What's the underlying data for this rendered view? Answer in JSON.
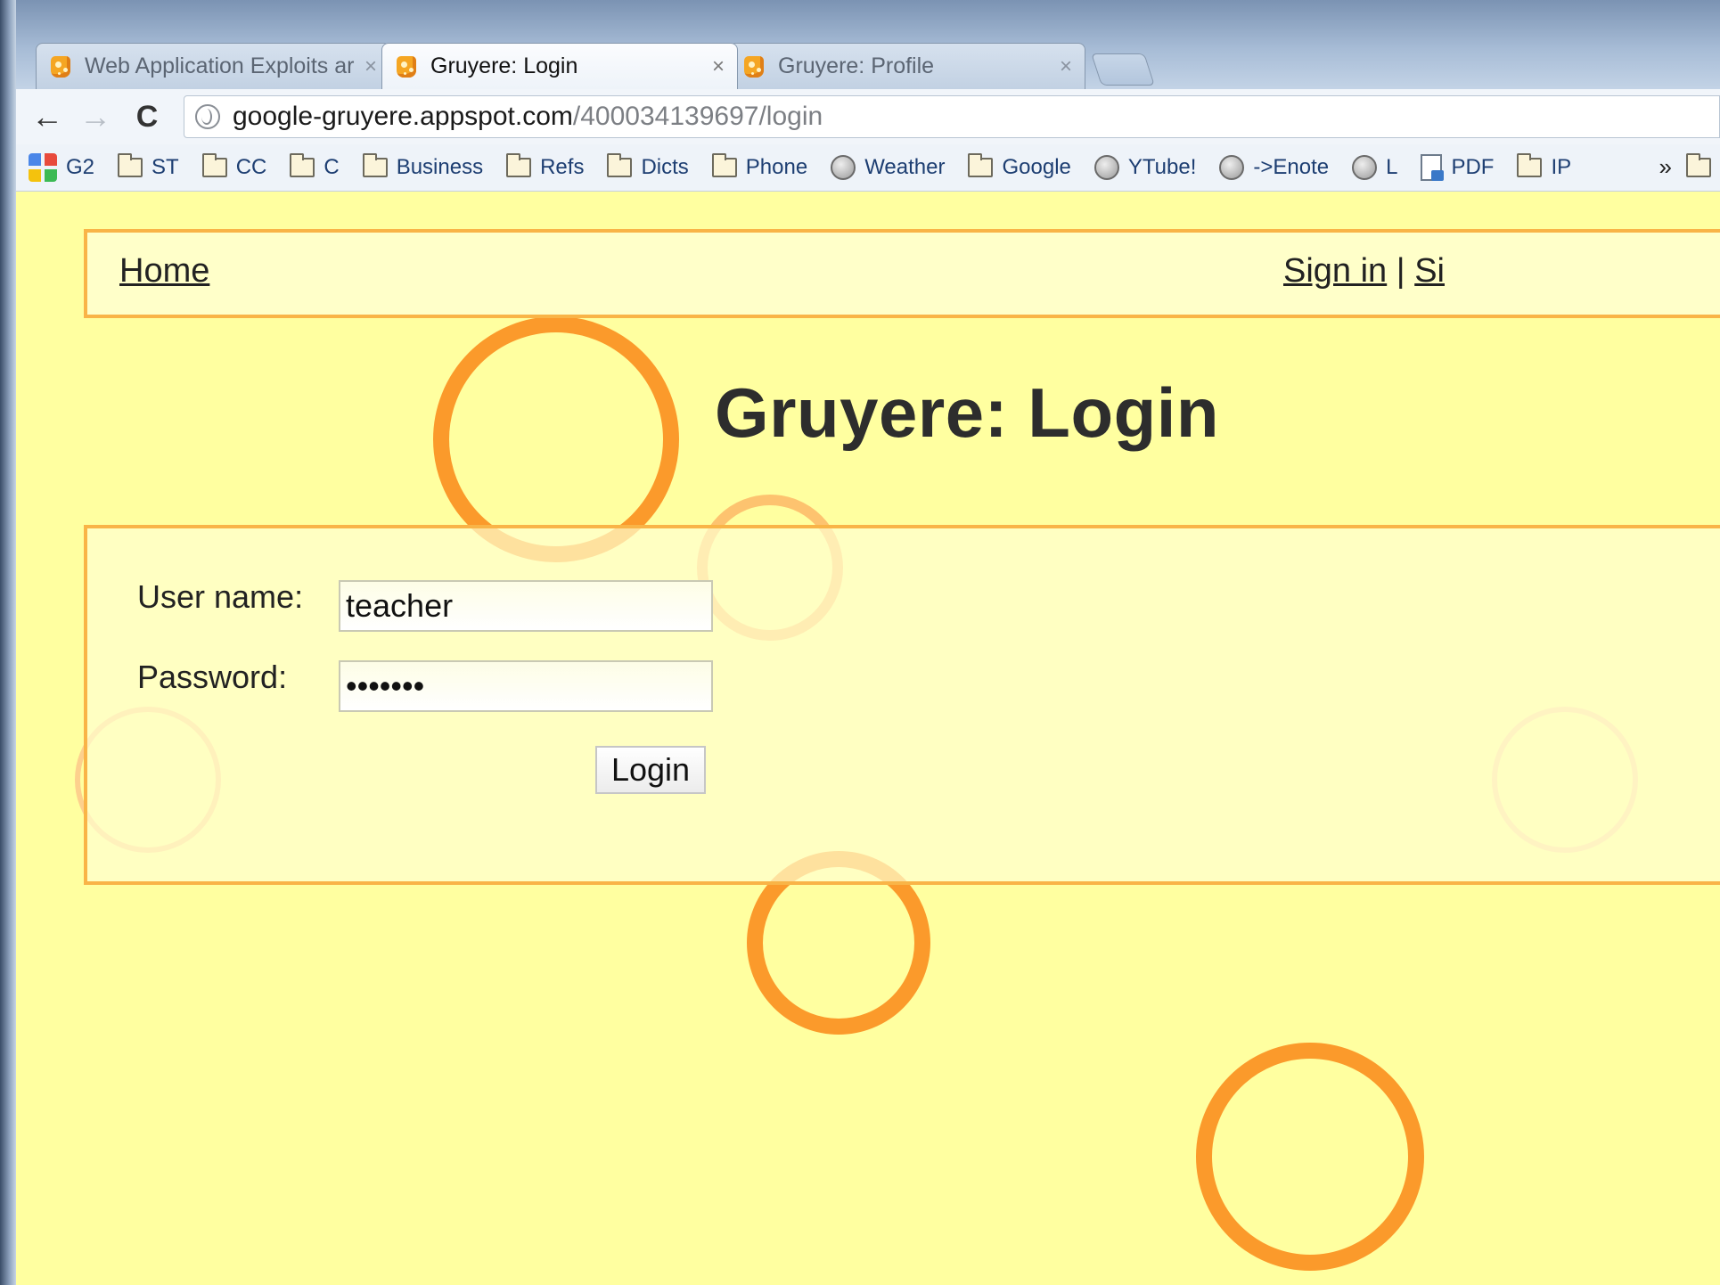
{
  "tabs": [
    {
      "title": "Web Application Exploits ar",
      "close": "×"
    },
    {
      "title": "Gruyere: Login",
      "close": "×"
    },
    {
      "title": "Gruyere: Profile",
      "close": "×"
    }
  ],
  "toolbar": {
    "back": "←",
    "forward": "→",
    "reload": "C",
    "url_host": "google-gruyere.appspot.com",
    "url_path": "/400034139697/login"
  },
  "bookmarks": [
    {
      "label": "G2",
      "icon": "g2-icon"
    },
    {
      "label": "ST",
      "icon": "folder-icon"
    },
    {
      "label": "CC",
      "icon": "folder-icon"
    },
    {
      "label": "C",
      "icon": "folder-icon"
    },
    {
      "label": "Business",
      "icon": "folder-icon"
    },
    {
      "label": "Refs",
      "icon": "folder-icon"
    },
    {
      "label": "Dicts",
      "icon": "folder-icon"
    },
    {
      "label": "Phone",
      "icon": "folder-icon"
    },
    {
      "label": "Weather",
      "icon": "globe-icon"
    },
    {
      "label": "Google",
      "icon": "folder-icon"
    },
    {
      "label": "YTube!",
      "icon": "globe-icon"
    },
    {
      "label": "->Enote",
      "icon": "globe-icon"
    },
    {
      "label": "L",
      "icon": "globe-icon"
    },
    {
      "label": "PDF",
      "icon": "pdf-icon"
    },
    {
      "label": "IP",
      "icon": "folder-icon"
    }
  ],
  "bookmarks_more": "»",
  "page": {
    "nav_home": "Home",
    "nav_signin": "Sign in",
    "nav_separator": "|",
    "nav_signup": "Si",
    "title": "Gruyere: Login",
    "username_label": "User name:",
    "username_value": "teacher",
    "password_label": "Password:",
    "password_value": "•••••••",
    "login_button": "Login"
  },
  "colors": {
    "page_background": "#ffffa0",
    "accent_orange": "#f9b447",
    "ring_orange": "#fb9a2b"
  }
}
